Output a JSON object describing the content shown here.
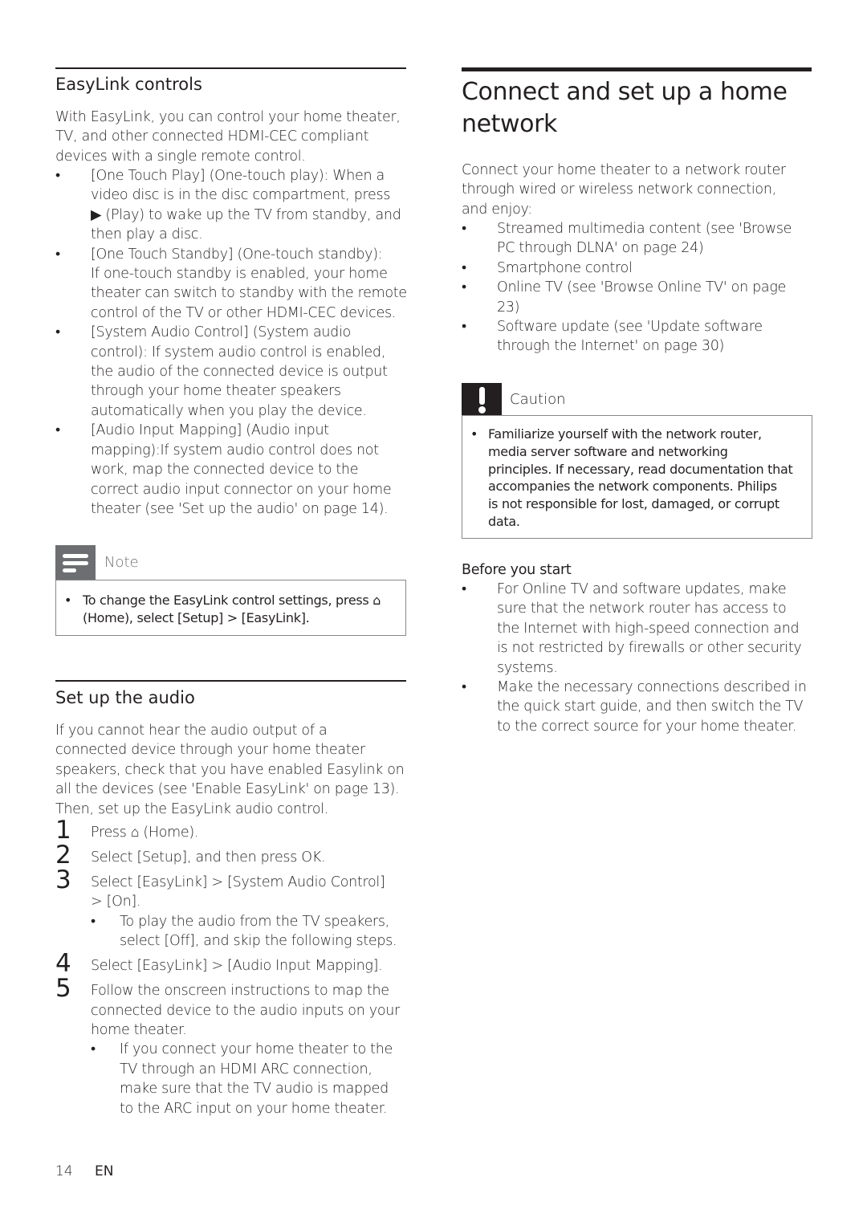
{
  "left": {
    "easylink": {
      "heading": "EasyLink controls",
      "intro": [
        "With EasyLink, you can control your home theater,",
        "TV, and other connected HDMI-CEC compliant",
        "devices with a single remote control."
      ],
      "items": [
        {
          "lines": [
            "[One Touch Play] (One-touch play): When a",
            "video disc is in the disc compartment, press",
            "▶ (Play) to wake up the TV from standby, and",
            "then play a disc."
          ]
        },
        {
          "lines": [
            "[One Touch Standby] (One-touch standby):",
            "If one-touch standby is enabled, your home",
            "theater can switch to standby with the remote",
            "control of the TV or other HDMI-CEC devices."
          ]
        },
        {
          "lines": [
            "[System Audio Control] (System audio",
            "control): If system audio control is enabled,",
            "the audio of the connected device is output",
            "through your home theater speakers",
            "automatically when you play the device."
          ]
        },
        {
          "lines": [
            "[Audio Input Mapping] (Audio input",
            "mapping):If system audio control does not",
            "work, map the connected device to the",
            "correct audio input connector on your home",
            "theater (see 'Set up the audio' on page 14)."
          ]
        }
      ]
    },
    "note": {
      "label": "Note",
      "lines": [
        "To change the EasyLink control settings, press ⌂",
        "(Home), select [Setup] > [EasyLink]."
      ]
    },
    "audio": {
      "heading": "Set up the audio",
      "intro": [
        "If you cannot hear the audio output of a",
        "connected device through your home theater",
        "speakers, check that you have enabled Easylink on",
        "all the devices (see 'Enable EasyLink' on page 13).",
        "Then, set up the EasyLink audio control."
      ],
      "steps": [
        {
          "n": "1",
          "lines": [
            "Press ⌂ (Home)."
          ]
        },
        {
          "n": "2",
          "lines": [
            "Select [Setup], and then press OK."
          ]
        },
        {
          "n": "3",
          "lines": [
            "Select [EasyLink] > [System Audio Control]",
            "> [On]."
          ],
          "sub": [
            "To play the audio from the TV speakers,",
            "select [Off], and skip the following steps."
          ]
        },
        {
          "n": "4",
          "lines": [
            "Select [EasyLink] > [Audio Input Mapping]."
          ]
        },
        {
          "n": "5",
          "lines": [
            "Follow the onscreen instructions to map the",
            "connected device to the audio inputs on your",
            "home theater."
          ],
          "sub": [
            "If you connect your home theater to the",
            "TV through an HDMI ARC connection,",
            "make sure that the TV audio is mapped",
            "to the ARC input on your home theater."
          ]
        }
      ]
    }
  },
  "right": {
    "heading_lines": [
      "Connect and set up a home",
      "network"
    ],
    "intro": [
      "Connect your home theater to a network router",
      "through wired or wireless network connection,",
      "and enjoy:"
    ],
    "items": [
      {
        "lines": [
          "Streamed multimedia content (see 'Browse",
          "PC through DLNA' on page 24)"
        ]
      },
      {
        "lines": [
          "Smartphone control"
        ]
      },
      {
        "lines": [
          "Online TV (see 'Browse Online TV' on page",
          "23)"
        ]
      },
      {
        "lines": [
          "Software update (see 'Update software",
          "through the Internet' on page 30)"
        ]
      }
    ],
    "caution": {
      "label": "Caution",
      "lines": [
        "Familiarize yourself with the network router,",
        "media server software and networking",
        "principles. If necessary, read documentation that",
        "accompanies the network components. Philips",
        "is not responsible for lost, damaged, or corrupt",
        "data."
      ]
    },
    "before": {
      "heading": "Before you start",
      "items": [
        {
          "lines": [
            "For Online TV and software updates, make",
            "sure that the network router has access to",
            "the Internet with high-speed connection and",
            "is not restricted by firewalls or other security",
            "systems."
          ]
        },
        {
          "lines": [
            "Make the necessary connections described in",
            "the quick start guide, and then switch the TV",
            "to the correct source for your home theater."
          ]
        }
      ]
    }
  },
  "footer": {
    "page": "14",
    "lang": "EN"
  },
  "bullet_char": "•"
}
